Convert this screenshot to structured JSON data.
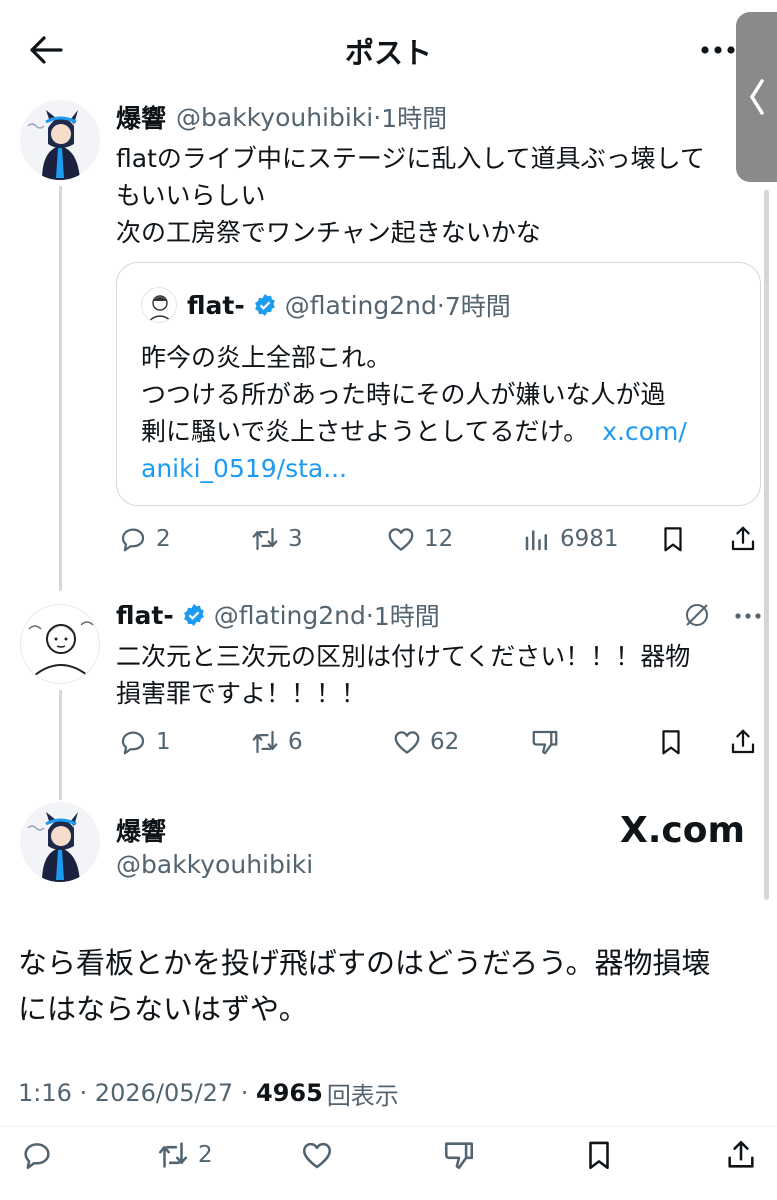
{
  "header": {
    "title": "ポスト"
  },
  "tweet1": {
    "name": "爆響",
    "handle": "@bakkyouhibiki",
    "time": "1時間",
    "lines": [
      "flatのライブ中にステージに乱入して道具ぶっ壊して",
      "もいいらしい",
      "次の工房祭でワンチャン起きないかな"
    ],
    "quote": {
      "name": "flat-",
      "handle": "@flating2nd",
      "time": "7時間",
      "line1": "昨今の炎上全部これ。",
      "line2": "つつける所があった時にその人が嫌いな人が過",
      "line3": "剰に騒いで炎上させようとしてるだけ。",
      "link1": "x.com/",
      "link2": "aniki_0519/sta..."
    },
    "replies": "2",
    "reposts": "3",
    "likes": "12",
    "views": "6981"
  },
  "tweet2": {
    "name": "flat-",
    "handle": "@flating2nd",
    "time": "1時間",
    "line1": "二次元と三次元の区別は付けてください！！！器物",
    "line2": "損害罪ですよ！！！！",
    "replies": "1",
    "reposts": "6",
    "likes": "62"
  },
  "main": {
    "name": "爆響",
    "handle": "@bakkyouhibiki",
    "brand": "X.com",
    "line1": "なら看板とかを投げ飛ばすのはどうだろう。器物損壊",
    "line2": "にはならないはずや。",
    "time": "1:16",
    "date": "2026/05/27",
    "views": "4965",
    "views_label": "回表示",
    "reposts": "2"
  },
  "colors": {
    "accent": "#1d9bf0",
    "text": "#0f1419",
    "muted": "#536471",
    "border": "#cfd9de"
  }
}
